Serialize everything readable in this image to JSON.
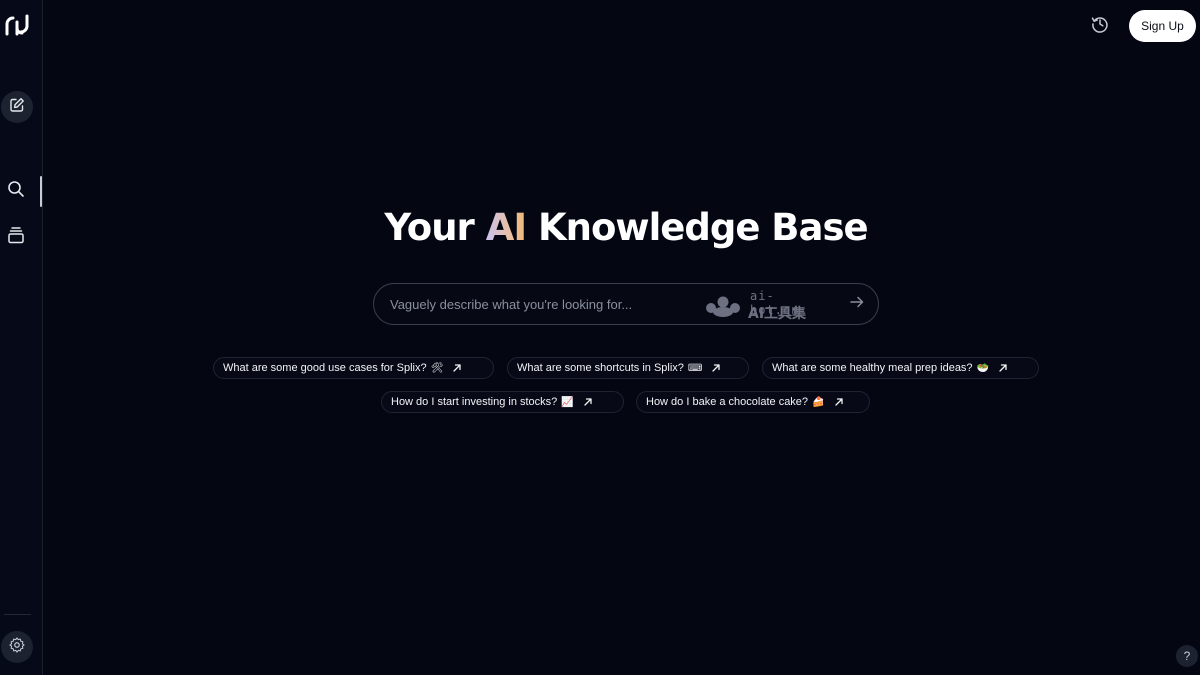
{
  "hero": {
    "title_prefix": "Your ",
    "title_accent": "AI",
    "title_suffix": " Knowledge Base"
  },
  "header": {
    "signup_label": "Sign Up"
  },
  "search": {
    "placeholder": "Vaguely describe what you're looking for...",
    "watermark_top": "ai-bot.cn",
    "watermark_bottom": "AI工具集"
  },
  "suggestions": [
    {
      "text": "What are some good use cases for Splix?",
      "emoji": "🛠"
    },
    {
      "text": "What are some shortcuts in Splix?",
      "emoji": "⌨"
    },
    {
      "text": "What are some healthy meal prep ideas?",
      "emoji": "🥗"
    },
    {
      "text": "How do I start investing in stocks?",
      "emoji": "📈"
    },
    {
      "text": "How do I bake a chocolate cake?",
      "emoji": "🍰"
    }
  ],
  "help": {
    "label": "?"
  },
  "colors": {
    "background": "#040612",
    "sidebar": "#060a18",
    "accent_gradient_start": "#c8c2ee",
    "accent_gradient_end": "#f0b878"
  },
  "icons": [
    "logo-icon",
    "edit-icon",
    "search-icon",
    "library-icon",
    "settings-icon",
    "history-icon",
    "arrow-right-icon",
    "arrow-up-right-icon"
  ]
}
